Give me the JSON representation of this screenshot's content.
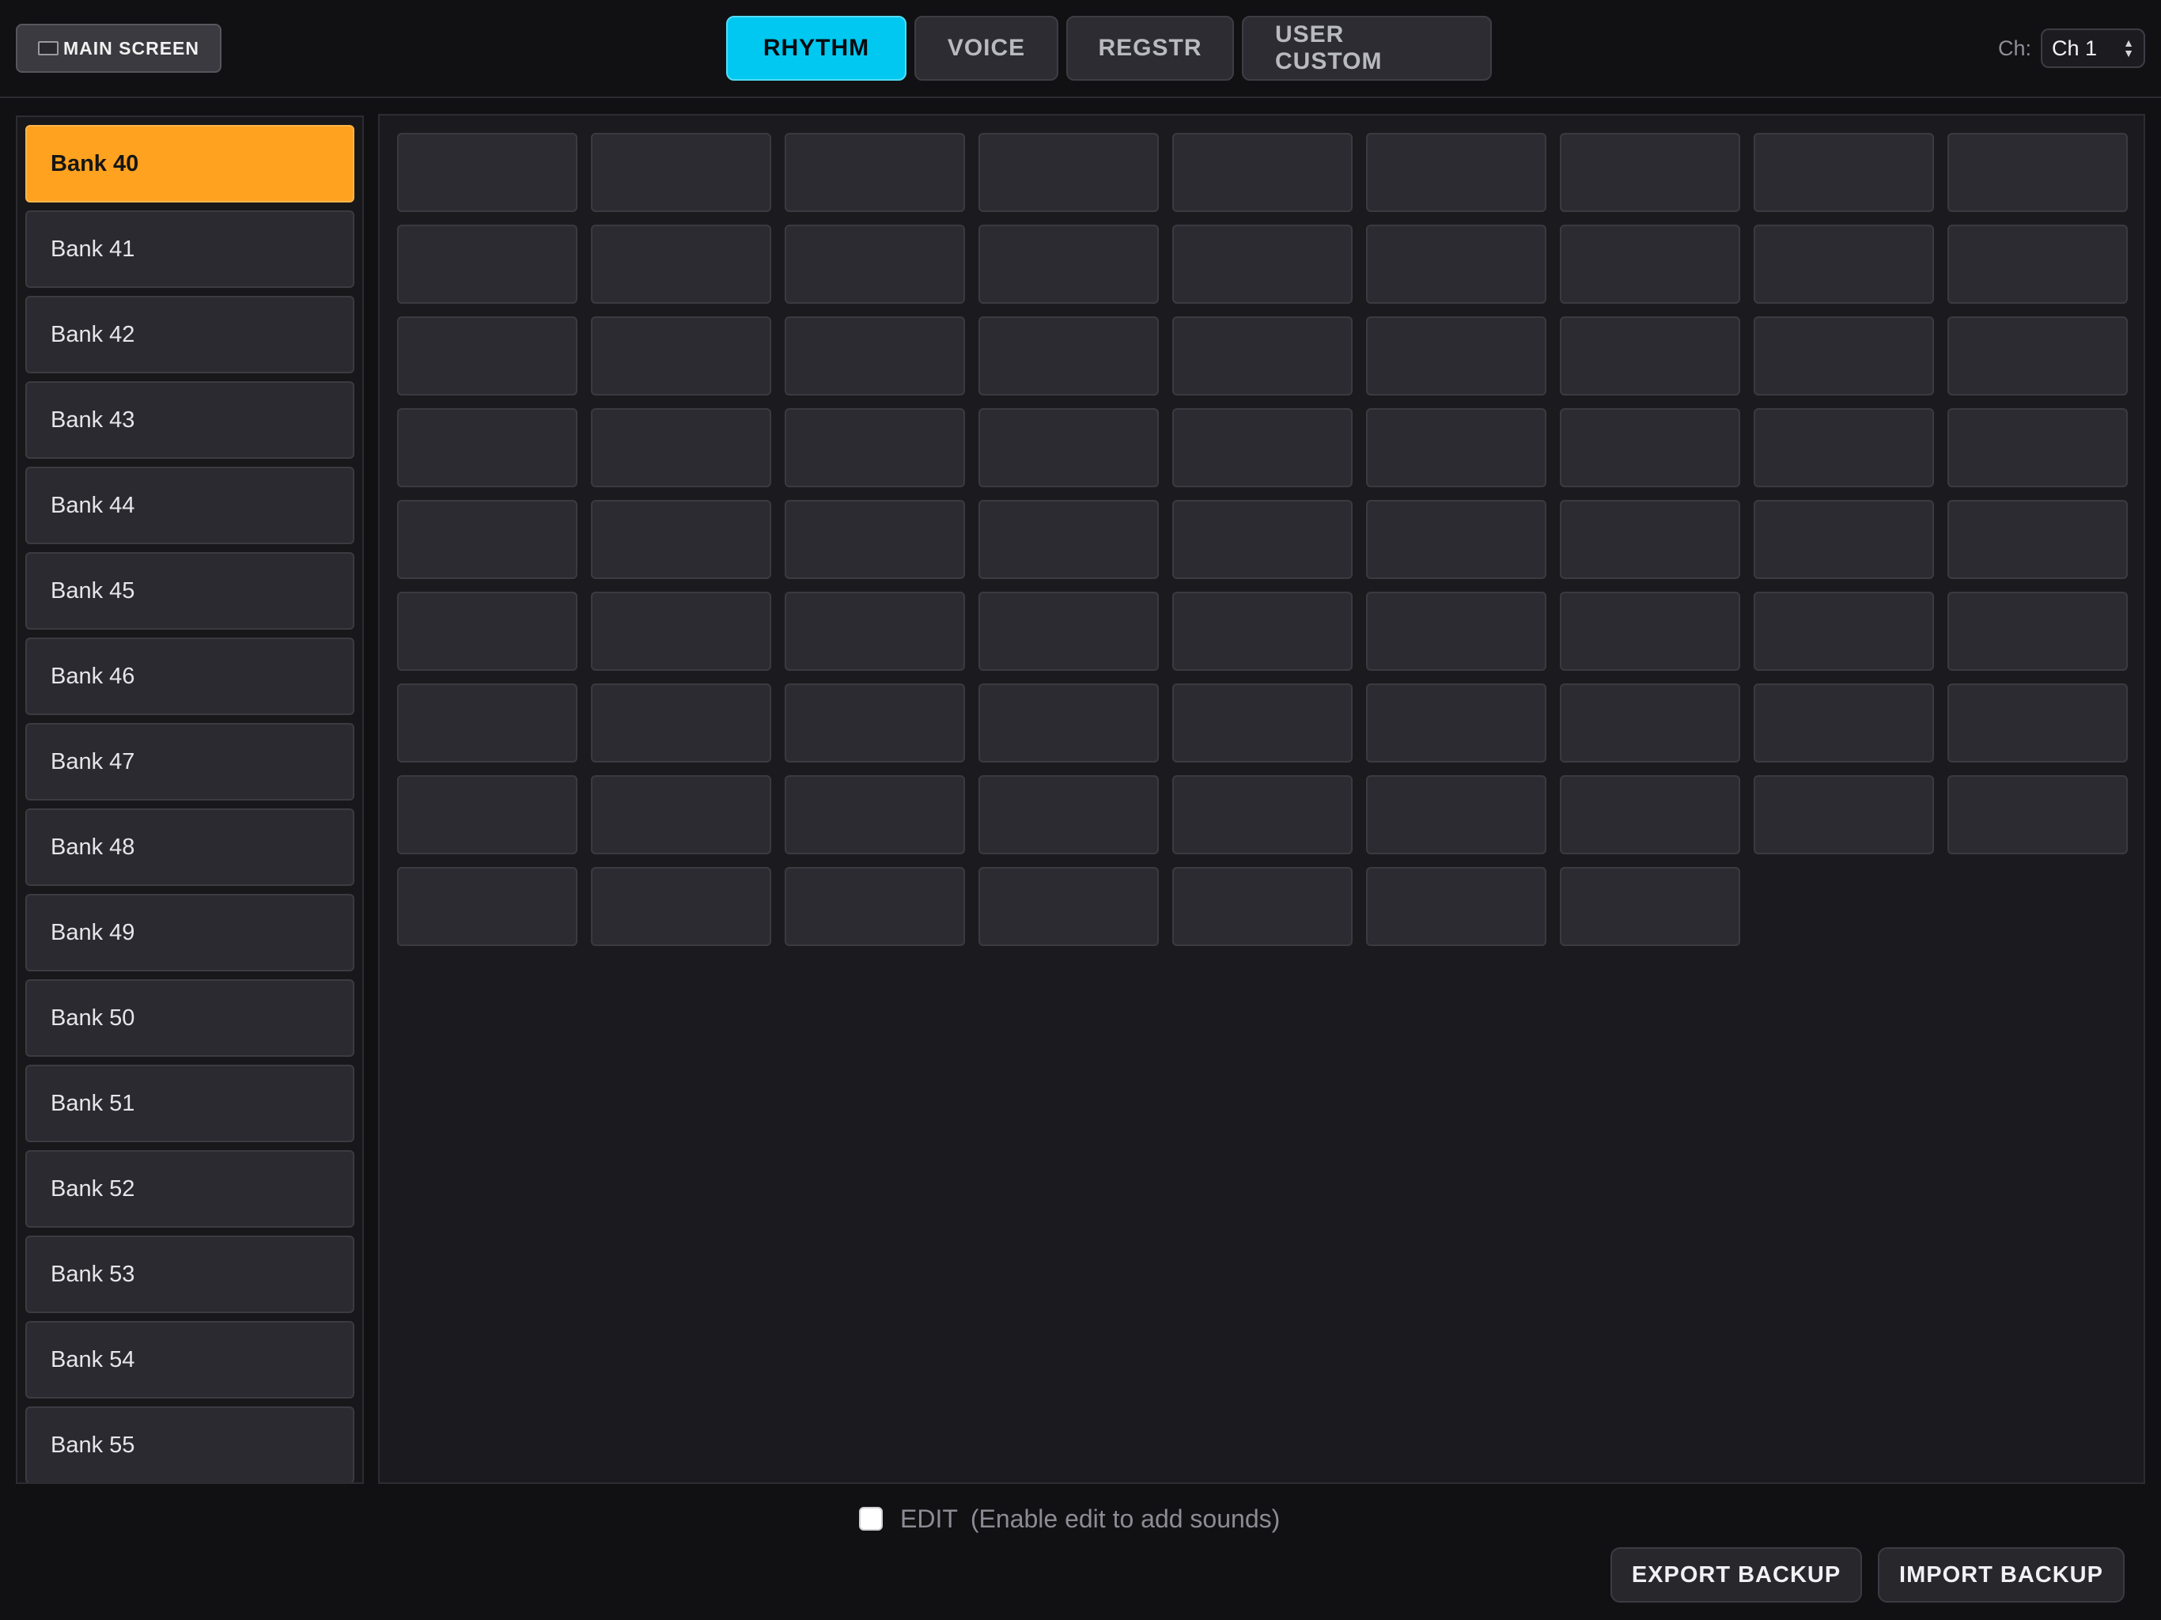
{
  "topbar": {
    "main_screen_label": "MAIN SCREEN",
    "tabs": [
      {
        "label": "RHYTHM",
        "active": true
      },
      {
        "label": "VOICE",
        "active": false
      },
      {
        "label": "REGSTR",
        "active": false
      },
      {
        "label": "USER CUSTOM",
        "active": false
      }
    ],
    "channel_label": "Ch:",
    "channel_value": "Ch 1"
  },
  "sidebar": {
    "banks": [
      {
        "label": "Bank 40",
        "active": true
      },
      {
        "label": "Bank 41",
        "active": false
      },
      {
        "label": "Bank 42",
        "active": false
      },
      {
        "label": "Bank 43",
        "active": false
      },
      {
        "label": "Bank 44",
        "active": false
      },
      {
        "label": "Bank 45",
        "active": false
      },
      {
        "label": "Bank 46",
        "active": false
      },
      {
        "label": "Bank 47",
        "active": false
      },
      {
        "label": "Bank 48",
        "active": false
      },
      {
        "label": "Bank 49",
        "active": false
      },
      {
        "label": "Bank 50",
        "active": false
      },
      {
        "label": "Bank 51",
        "active": false
      },
      {
        "label": "Bank 52",
        "active": false
      },
      {
        "label": "Bank 53",
        "active": false
      },
      {
        "label": "Bank 54",
        "active": false
      },
      {
        "label": "Bank 55",
        "active": false
      }
    ]
  },
  "grid": {
    "pad_count": 79
  },
  "bottom": {
    "edit_label": "EDIT",
    "edit_hint": "(Enable edit to add sounds)",
    "edit_checked": false,
    "export_label": "EXPORT BACKUP",
    "import_label": "IMPORT BACKUP"
  },
  "colors": {
    "accent_active_tab": "#00c8f0",
    "accent_active_bank": "#ffa21f",
    "background": "#111114"
  }
}
